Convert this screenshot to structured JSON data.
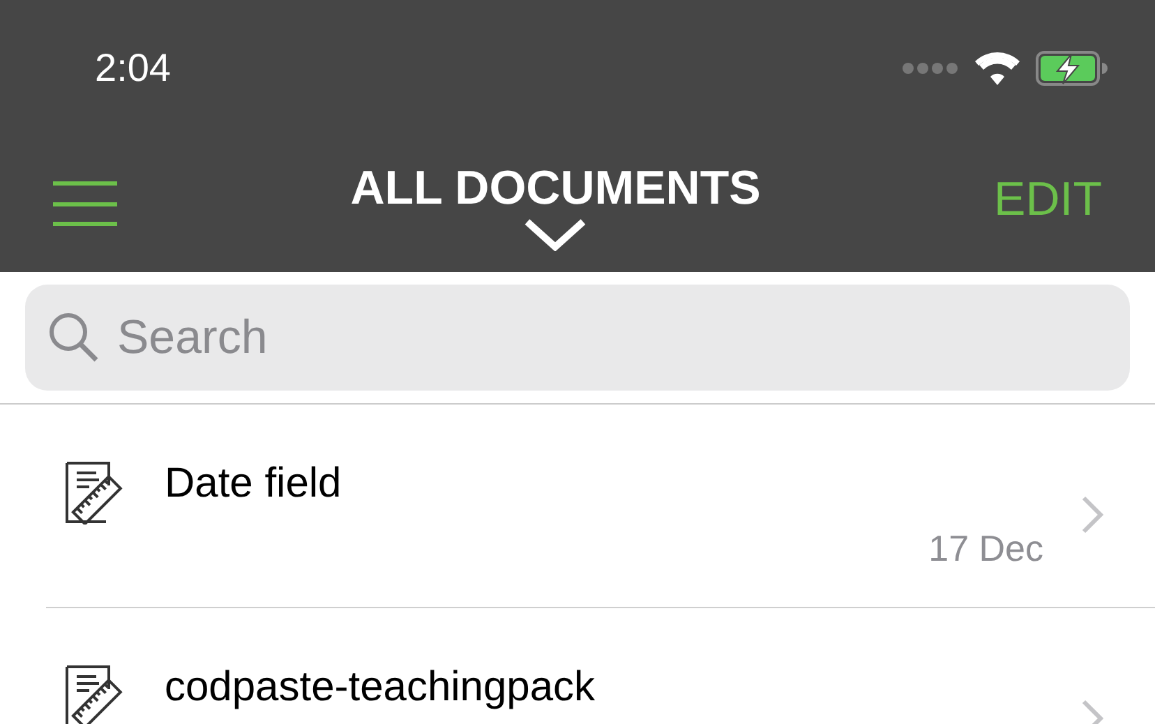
{
  "status_bar": {
    "time": "2:04",
    "charging": true
  },
  "nav": {
    "title": "ALL DOCUMENTS",
    "edit": "EDIT"
  },
  "search": {
    "placeholder": "Search"
  },
  "documents": [
    {
      "title": "Date field",
      "date": "17 Dec"
    },
    {
      "title": "codpaste-teachingpack"
    }
  ]
}
